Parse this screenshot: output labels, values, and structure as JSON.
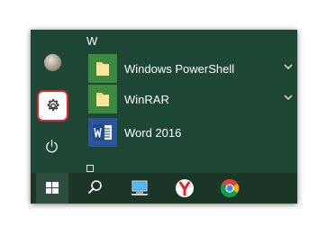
{
  "start_menu": {
    "section_header": "W",
    "apps": [
      {
        "label": "Windows PowerShell",
        "icon": "folder-icon",
        "expandable": true
      },
      {
        "label": "WinRAR",
        "icon": "folder-icon",
        "expandable": true
      },
      {
        "label": "Word 2016",
        "icon": "word-icon",
        "expandable": false
      }
    ],
    "next_section_icon": "section-header-box-icon"
  },
  "rail": {
    "items": [
      "user-avatar",
      "settings-gear-icon",
      "power-icon"
    ],
    "highlight_color": "#e0262b"
  },
  "taskbar": {
    "items": [
      "windows-start-icon",
      "search-icon",
      "computer-icon",
      "yandex-browser-icon",
      "chrome-icon"
    ]
  },
  "colors": {
    "start_background": "#1d4734",
    "taskbar_background": "#1b3527",
    "tile_green": "#3b8a3f",
    "tile_blue": "#2b579a"
  }
}
